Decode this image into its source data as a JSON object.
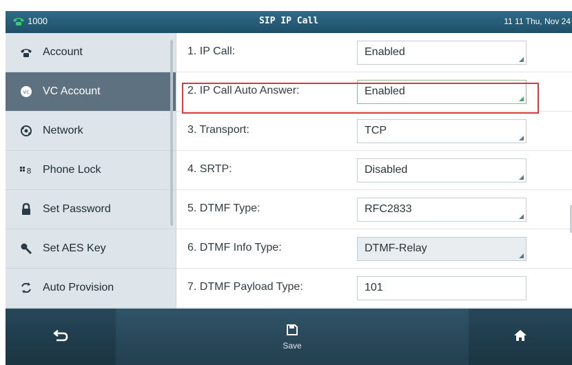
{
  "status_bar": {
    "account": "1000",
    "title": "SIP IP Call",
    "clock": "11 11 Thu, Nov 24"
  },
  "sidebar": {
    "items": [
      {
        "label": "Account",
        "icon": "phone-icon"
      },
      {
        "label": "VC Account",
        "icon": "vc-icon",
        "selected": true
      },
      {
        "label": "Network",
        "icon": "network-icon"
      },
      {
        "label": "Phone Lock",
        "icon": "phone-lock-icon"
      },
      {
        "label": "Set Password",
        "icon": "lock-icon"
      },
      {
        "label": "Set AES Key",
        "icon": "key-icon"
      },
      {
        "label": "Auto Provision",
        "icon": "refresh-icon"
      }
    ]
  },
  "form": {
    "rows": [
      {
        "label": "1. IP Call:",
        "value": "Enabled"
      },
      {
        "label": "2. IP Call Auto Answer:",
        "value": "Enabled",
        "highlighted": true
      },
      {
        "label": "3. Transport:",
        "value": "TCP"
      },
      {
        "label": "4. SRTP:",
        "value": "Disabled"
      },
      {
        "label": "5. DTMF Type:",
        "value": "RFC2833"
      },
      {
        "label": "6. DTMF Info Type:",
        "value": "DTMF-Relay",
        "disabled": true
      },
      {
        "label": "7. DTMF Payload Type:",
        "value": "101"
      }
    ]
  },
  "bottom_bar": {
    "back_icon": "back-arrow-icon",
    "save_label": "Save",
    "save_icon": "save-icon",
    "home_icon": "home-icon"
  },
  "colors": {
    "status_bar": "#2f6b88",
    "sidebar_selected": "#5d7180",
    "highlight_border": "#d63b3b",
    "bottom_bar": "#264759"
  }
}
